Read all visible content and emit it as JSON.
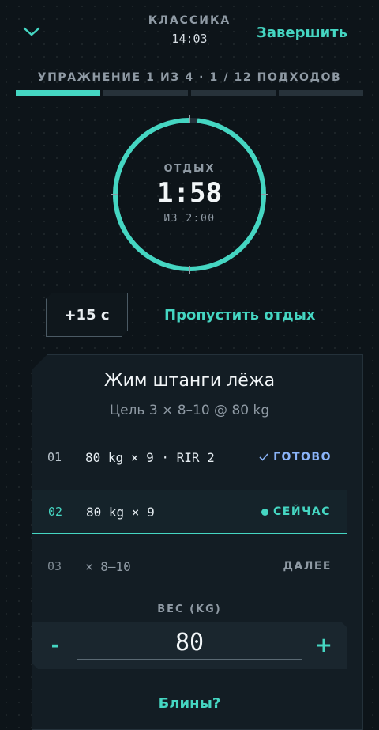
{
  "header": {
    "title": "КЛАССИКА",
    "time": "14:03",
    "finish_label": "Завершить",
    "collapse_icon": "chevron-down-icon"
  },
  "progress": {
    "label": "УПРАЖНЕНИЕ 1 ИЗ 4 · 1 / 12 ПОДХОДОВ",
    "segments_total": 4,
    "segments_done": 1
  },
  "timer": {
    "label": "ОТДЫХ",
    "time": "1:58",
    "total": "ИЗ 2:00",
    "remaining_fraction": 0.983
  },
  "actions": {
    "add_time": "+15 с",
    "skip_rest": "Пропустить отдых"
  },
  "exercise": {
    "title": "Жим штанги лёжа",
    "goal": "Цель 3 × 8–10 @ 80 kg",
    "sets": [
      {
        "num": "01",
        "desc": "80 kg × 9 · RIR 2",
        "status": "ГОТОВО",
        "state": "done"
      },
      {
        "num": "02",
        "desc": "80 kg × 9",
        "status": "СЕЙЧАС",
        "state": "current"
      },
      {
        "num": "03",
        "desc": "× 8–10",
        "status": "ДАЛЕЕ",
        "state": "next"
      }
    ]
  },
  "weight": {
    "label": "ВЕС (KG)",
    "value": "80",
    "minus": "-",
    "plus": "+"
  },
  "plates_link": "Блины?",
  "colors": {
    "accent": "#45d6c2",
    "background": "#0d1419",
    "card": "#131d24",
    "done": "#8ab4f8"
  }
}
